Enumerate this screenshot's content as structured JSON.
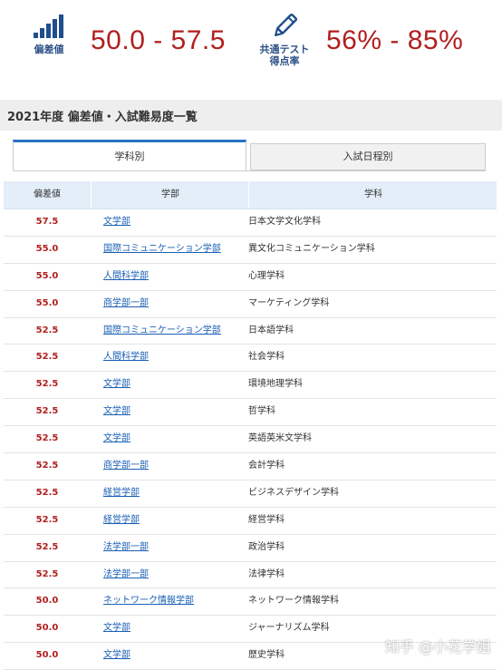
{
  "header": {
    "deviation": {
      "caption": "偏差値",
      "icon": "bar-chart-icon",
      "value": "50.0 - 57.5"
    },
    "kyotsu": {
      "caption": "共通テスト\n得点率",
      "icon": "pencil-icon",
      "value": "56% - 85%"
    }
  },
  "section": {
    "title": "2021年度 偏差値・入試難易度一覧"
  },
  "tabs": [
    {
      "label": "学科別",
      "active": true
    },
    {
      "label": "入試日程別",
      "active": false
    }
  ],
  "table": {
    "headers": {
      "score": "偏差値",
      "dept": "学部",
      "major": "学科"
    },
    "rows": [
      {
        "score": "57.5",
        "dept": "文学部",
        "major": "日本文学文化学科"
      },
      {
        "score": "55.0",
        "dept": "国際コミュニケーション学部",
        "major": "異文化コミュニケーション学科"
      },
      {
        "score": "55.0",
        "dept": "人間科学部",
        "major": "心理学科"
      },
      {
        "score": "55.0",
        "dept": "商学部一部",
        "major": "マーケティング学科"
      },
      {
        "score": "52.5",
        "dept": "国際コミュニケーション学部",
        "major": "日本語学科"
      },
      {
        "score": "52.5",
        "dept": "人間科学部",
        "major": "社会学科"
      },
      {
        "score": "52.5",
        "dept": "文学部",
        "major": "環境地理学科"
      },
      {
        "score": "52.5",
        "dept": "文学部",
        "major": "哲学科"
      },
      {
        "score": "52.5",
        "dept": "文学部",
        "major": "英語英米文学科"
      },
      {
        "score": "52.5",
        "dept": "商学部一部",
        "major": "会計学科"
      },
      {
        "score": "52.5",
        "dept": "経営学部",
        "major": "ビジネスデザイン学科"
      },
      {
        "score": "52.5",
        "dept": "経営学部",
        "major": "経営学科"
      },
      {
        "score": "52.5",
        "dept": "法学部一部",
        "major": "政治学科"
      },
      {
        "score": "52.5",
        "dept": "法学部一部",
        "major": "法律学科"
      },
      {
        "score": "50.0",
        "dept": "ネットワーク情報学部",
        "major": "ネットワーク情報学科"
      },
      {
        "score": "50.0",
        "dept": "文学部",
        "major": "ジャーナリズム学科"
      },
      {
        "score": "50.0",
        "dept": "文学部",
        "major": "歴史学科"
      }
    ]
  },
  "watermark": {
    "text": "知乎 @小花学姐"
  },
  "colors": {
    "accent_red": "#b11f1f",
    "link_blue": "#1a5fb4",
    "header_blue": "#2a4f86",
    "table_head": "#e3eef9"
  }
}
